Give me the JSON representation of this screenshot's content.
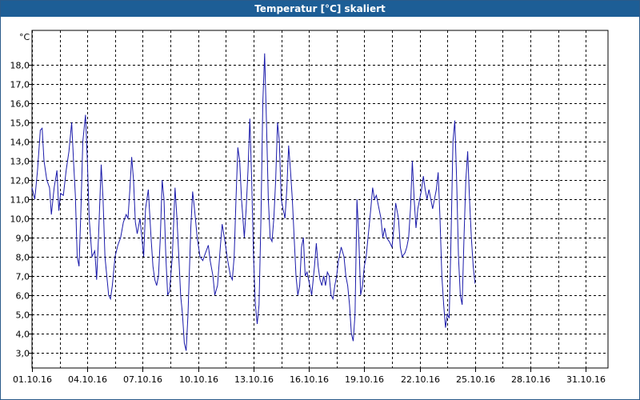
{
  "window": {
    "title": "Temperatur [°C] skaliert"
  },
  "chart_data": {
    "type": "line",
    "title": "Temperatur [°C] skaliert",
    "ylabel": "°C",
    "xlabel": "",
    "grid": true,
    "line_color": "#1a1aaa",
    "ylim": [
      2.2,
      19.8
    ],
    "y_ticks": [
      3.0,
      4.0,
      5.0,
      6.0,
      7.0,
      8.0,
      9.0,
      10.0,
      11.0,
      12.0,
      13.0,
      14.0,
      15.0,
      16.0,
      17.0,
      18.0
    ],
    "y_tick_labels": [
      "3,0",
      "4,0",
      "5,0",
      "6,0",
      "7,0",
      "8,0",
      "9,0",
      "10,0",
      "11,0",
      "12,0",
      "13,0",
      "14,0",
      "15,0",
      "16,0",
      "17,0",
      "18,0"
    ],
    "x_range_days": [
      0,
      31.2
    ],
    "x_ticks": [
      0,
      3,
      6,
      9,
      12,
      15,
      18,
      21,
      24,
      27,
      30
    ],
    "x_tick_labels": [
      "01.10.16",
      "04.10.16",
      "07.10.16",
      "10.10.16",
      "13.10.16",
      "16.10.16",
      "19.10.16",
      "22.10.16",
      "25.10.16",
      "28.10.16",
      "31.10.16"
    ],
    "x_minor_ticks": [
      1.5,
      4.5,
      7.5,
      10.5,
      13.5,
      16.5,
      19.5,
      22.5,
      25.5,
      28.5
    ],
    "series": [
      {
        "values": [
          [
            0.0,
            11.6
          ],
          [
            0.15,
            11.0
          ],
          [
            0.3,
            12.5
          ],
          [
            0.45,
            14.6
          ],
          [
            0.55,
            14.7
          ],
          [
            0.65,
            13.0
          ],
          [
            0.8,
            12.0
          ],
          [
            0.95,
            11.6
          ],
          [
            1.05,
            10.2
          ],
          [
            1.2,
            11.6
          ],
          [
            1.35,
            12.5
          ],
          [
            1.45,
            10.4
          ],
          [
            1.55,
            11.3
          ],
          [
            1.7,
            11.2
          ],
          [
            1.85,
            12.5
          ],
          [
            2.0,
            13.5
          ],
          [
            2.15,
            15.0
          ],
          [
            2.25,
            13.0
          ],
          [
            2.35,
            11.2
          ],
          [
            2.45,
            8.0
          ],
          [
            2.55,
            7.5
          ],
          [
            2.65,
            10.5
          ],
          [
            2.75,
            14.0
          ],
          [
            2.9,
            15.4
          ],
          [
            3.0,
            13.0
          ],
          [
            3.1,
            10.0
          ],
          [
            3.25,
            8.0
          ],
          [
            3.4,
            8.3
          ],
          [
            3.5,
            6.8
          ],
          [
            3.6,
            9.0
          ],
          [
            3.75,
            12.8
          ],
          [
            3.85,
            11.0
          ],
          [
            3.95,
            8.0
          ],
          [
            4.05,
            7.0
          ],
          [
            4.15,
            6.0
          ],
          [
            4.25,
            5.8
          ],
          [
            4.35,
            6.5
          ],
          [
            4.5,
            8.0
          ],
          [
            4.65,
            8.6
          ],
          [
            4.8,
            9.0
          ],
          [
            4.95,
            9.8
          ],
          [
            5.1,
            10.2
          ],
          [
            5.2,
            10.0
          ],
          [
            5.3,
            11.5
          ],
          [
            5.4,
            13.2
          ],
          [
            5.5,
            12.0
          ],
          [
            5.6,
            9.8
          ],
          [
            5.7,
            9.2
          ],
          [
            5.85,
            10.0
          ],
          [
            5.95,
            9.0
          ],
          [
            6.05,
            8.0
          ],
          [
            6.15,
            10.5
          ],
          [
            6.3,
            11.5
          ],
          [
            6.45,
            9.0
          ],
          [
            6.55,
            7.5
          ],
          [
            6.65,
            6.8
          ],
          [
            6.75,
            6.5
          ],
          [
            6.85,
            7.0
          ],
          [
            6.95,
            9.0
          ],
          [
            7.05,
            12.0
          ],
          [
            7.15,
            11.0
          ],
          [
            7.25,
            8.0
          ],
          [
            7.35,
            6.0
          ],
          [
            7.45,
            6.2
          ],
          [
            7.6,
            8.0
          ],
          [
            7.75,
            11.6
          ],
          [
            7.85,
            10.0
          ],
          [
            7.95,
            8.0
          ],
          [
            8.05,
            6.0
          ],
          [
            8.15,
            5.0
          ],
          [
            8.25,
            3.5
          ],
          [
            8.35,
            3.1
          ],
          [
            8.45,
            5.0
          ],
          [
            8.6,
            9.5
          ],
          [
            8.7,
            11.4
          ],
          [
            8.8,
            10.5
          ],
          [
            8.95,
            9.0
          ],
          [
            9.1,
            8.0
          ],
          [
            9.25,
            7.8
          ],
          [
            9.4,
            8.2
          ],
          [
            9.55,
            8.6
          ],
          [
            9.65,
            7.8
          ],
          [
            9.8,
            7.0
          ],
          [
            9.9,
            6.0
          ],
          [
            10.05,
            6.5
          ],
          [
            10.2,
            8.5
          ],
          [
            10.3,
            9.7
          ],
          [
            10.45,
            8.8
          ],
          [
            10.6,
            7.8
          ],
          [
            10.75,
            7.0
          ],
          [
            10.85,
            6.8
          ],
          [
            10.95,
            8.0
          ],
          [
            11.05,
            11.0
          ],
          [
            11.15,
            13.7
          ],
          [
            11.25,
            13.0
          ],
          [
            11.35,
            11.0
          ],
          [
            11.5,
            9.0
          ],
          [
            11.6,
            10.5
          ],
          [
            11.7,
            12.5
          ],
          [
            11.8,
            15.2
          ],
          [
            11.9,
            12.0
          ],
          [
            12.0,
            8.0
          ],
          [
            12.1,
            5.5
          ],
          [
            12.2,
            4.5
          ],
          [
            12.3,
            5.5
          ],
          [
            12.4,
            10.0
          ],
          [
            12.5,
            16.0
          ],
          [
            12.6,
            18.6
          ],
          [
            12.7,
            15.0
          ],
          [
            12.8,
            11.0
          ],
          [
            12.9,
            9.0
          ],
          [
            13.0,
            8.8
          ],
          [
            13.1,
            10.0
          ],
          [
            13.2,
            12.0
          ],
          [
            13.3,
            15.0
          ],
          [
            13.4,
            14.0
          ],
          [
            13.5,
            11.0
          ],
          [
            13.6,
            10.5
          ],
          [
            13.7,
            10.0
          ],
          [
            13.8,
            11.5
          ],
          [
            13.9,
            13.8
          ],
          [
            14.0,
            12.5
          ],
          [
            14.1,
            11.0
          ],
          [
            14.2,
            9.0
          ],
          [
            14.3,
            7.0
          ],
          [
            14.4,
            6.0
          ],
          [
            14.5,
            6.5
          ],
          [
            14.6,
            8.5
          ],
          [
            14.7,
            9.0
          ],
          [
            14.8,
            7.0
          ],
          [
            14.9,
            7.2
          ],
          [
            15.05,
            6.5
          ],
          [
            15.15,
            6.0
          ],
          [
            15.3,
            7.5
          ],
          [
            15.4,
            8.7
          ],
          [
            15.5,
            7.5
          ],
          [
            15.6,
            6.8
          ],
          [
            15.7,
            6.5
          ],
          [
            15.8,
            7.0
          ],
          [
            15.9,
            6.5
          ],
          [
            16.0,
            7.2
          ],
          [
            16.1,
            7.0
          ],
          [
            16.2,
            6.0
          ],
          [
            16.3,
            5.8
          ],
          [
            16.4,
            6.5
          ],
          [
            16.5,
            7.0
          ],
          [
            16.6,
            7.8
          ],
          [
            16.75,
            8.5
          ],
          [
            16.9,
            8.0
          ],
          [
            17.0,
            7.0
          ],
          [
            17.1,
            6.5
          ],
          [
            17.2,
            5.5
          ],
          [
            17.3,
            4.0
          ],
          [
            17.4,
            3.6
          ],
          [
            17.5,
            5.0
          ],
          [
            17.6,
            11.0
          ],
          [
            17.7,
            9.0
          ],
          [
            17.8,
            6.0
          ],
          [
            17.9,
            6.5
          ],
          [
            18.0,
            7.5
          ],
          [
            18.1,
            8.0
          ],
          [
            18.25,
            9.5
          ],
          [
            18.35,
            10.5
          ],
          [
            18.45,
            11.6
          ],
          [
            18.55,
            11.0
          ],
          [
            18.65,
            11.2
          ],
          [
            18.8,
            10.5
          ],
          [
            18.9,
            10.0
          ],
          [
            19.0,
            9.0
          ],
          [
            19.1,
            9.5
          ],
          [
            19.2,
            9.0
          ],
          [
            19.35,
            8.8
          ],
          [
            19.5,
            8.5
          ],
          [
            19.6,
            9.5
          ],
          [
            19.7,
            10.8
          ],
          [
            19.85,
            10.0
          ],
          [
            19.95,
            8.5
          ],
          [
            20.05,
            8.0
          ],
          [
            20.2,
            8.2
          ],
          [
            20.3,
            8.5
          ],
          [
            20.4,
            9.0
          ],
          [
            20.5,
            10.5
          ],
          [
            20.6,
            13.0
          ],
          [
            20.7,
            11.0
          ],
          [
            20.8,
            9.5
          ],
          [
            20.9,
            10.5
          ],
          [
            21.0,
            11.0
          ],
          [
            21.1,
            11.5
          ],
          [
            21.2,
            12.2
          ],
          [
            21.3,
            11.5
          ],
          [
            21.4,
            11.0
          ],
          [
            21.5,
            11.5
          ],
          [
            21.6,
            11.0
          ],
          [
            21.7,
            10.5
          ],
          [
            21.8,
            11.0
          ],
          [
            21.9,
            11.5
          ],
          [
            22.0,
            12.4
          ],
          [
            22.1,
            10.0
          ],
          [
            22.2,
            7.0
          ],
          [
            22.3,
            5.5
          ],
          [
            22.4,
            4.3
          ],
          [
            22.5,
            5.0
          ],
          [
            22.6,
            4.8
          ],
          [
            22.7,
            9.0
          ],
          [
            22.8,
            14.0
          ],
          [
            22.9,
            15.1
          ],
          [
            23.0,
            12.0
          ],
          [
            23.1,
            8.0
          ],
          [
            23.2,
            6.0
          ],
          [
            23.3,
            5.5
          ],
          [
            23.4,
            9.0
          ],
          [
            23.5,
            12.0
          ],
          [
            23.6,
            13.5
          ],
          [
            23.7,
            11.0
          ],
          [
            23.8,
            9.0
          ],
          [
            23.9,
            7.5
          ],
          [
            24.0,
            6.6
          ]
        ]
      }
    ]
  }
}
